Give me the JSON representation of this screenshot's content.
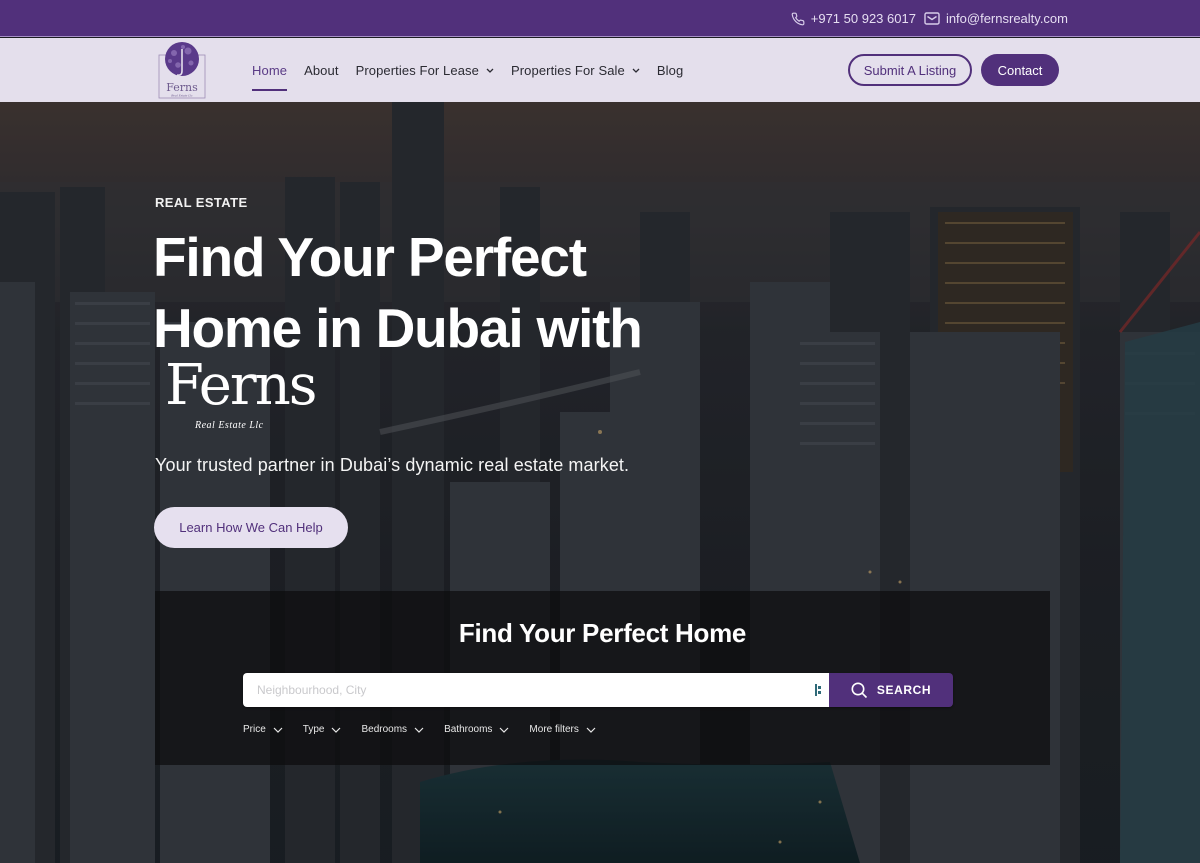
{
  "topbar": {
    "phone": "+971 50 923 6017",
    "email": "info@fernsrealty.com",
    "phone_icon": "phone-icon",
    "email_icon": "mail-icon"
  },
  "header": {
    "logo_text": "Ferns",
    "nav": [
      {
        "label": "Home",
        "active": true,
        "dropdown": false
      },
      {
        "label": "About",
        "active": false,
        "dropdown": false
      },
      {
        "label": "Properties For Lease",
        "active": false,
        "dropdown": true
      },
      {
        "label": "Properties For Sale",
        "active": false,
        "dropdown": true
      },
      {
        "label": "Blog",
        "active": false,
        "dropdown": false
      }
    ],
    "submit_listing_label": "Submit A Listing",
    "contact_label": "Contact"
  },
  "hero": {
    "eyebrow": "REAL ESTATE",
    "headline_line1": "Find Your Perfect",
    "headline_line2": "Home in Dubai with",
    "brand_big": "Ferns",
    "brand_small": "Real Estate Llc",
    "tagline": "Your trusted partner in Dubai’s dynamic real estate market.",
    "cta_label": "Learn How We Can Help"
  },
  "search": {
    "title": "Find Your Perfect Home",
    "placeholder": "Neighbourhood, City",
    "value": "",
    "button_label": "SEARCH",
    "filters": [
      "Price",
      "Type",
      "Bedrooms",
      "Bathrooms",
      "More filters"
    ]
  },
  "colors": {
    "brand_purple": "#51307b",
    "header_bg": "#e4dfec",
    "cta_bg": "#e6e0ef"
  }
}
